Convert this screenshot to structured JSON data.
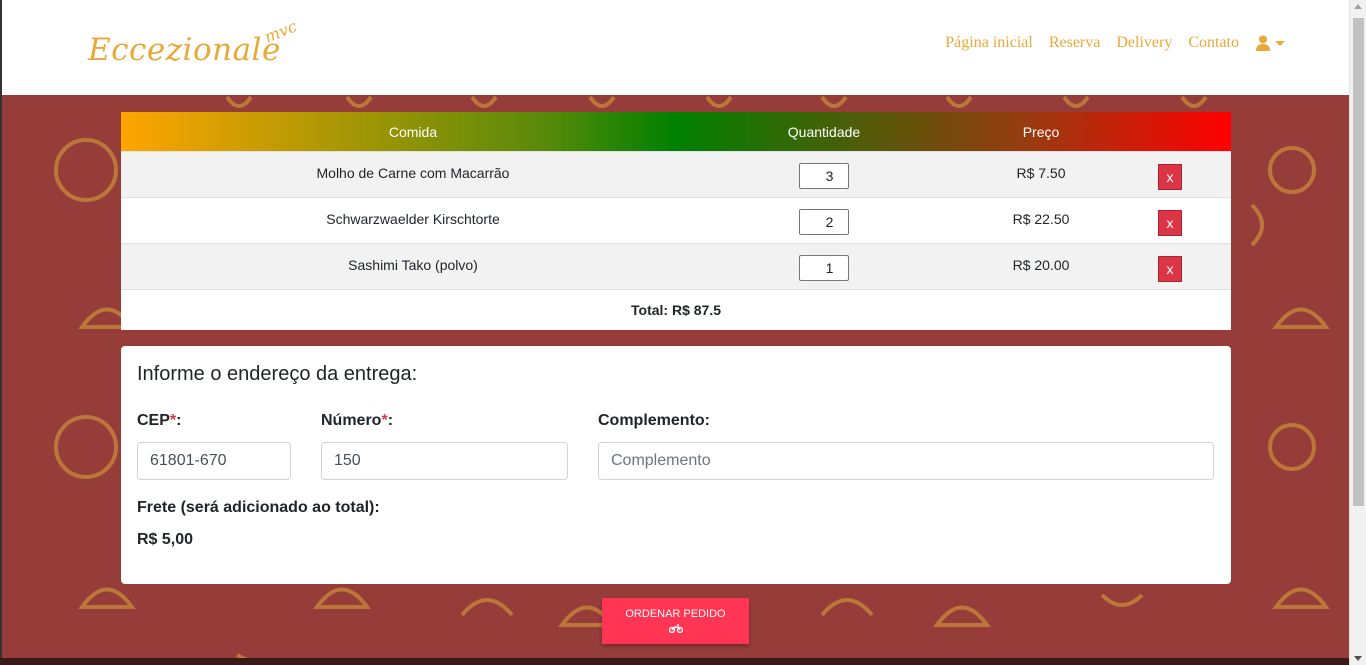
{
  "header": {
    "logo_main": "Eccezionale",
    "logo_sub": "mvc",
    "nav": [
      {
        "label": "Página inicial"
      },
      {
        "label": "Reserva"
      },
      {
        "label": "Delivery"
      },
      {
        "label": "Contato"
      }
    ],
    "user_icon": "user-icon",
    "accent_color": "#e8a938"
  },
  "cart": {
    "columns": {
      "food": "Comida",
      "quantity": "Quantidade",
      "price": "Preço"
    },
    "rows": [
      {
        "food": "Molho de Carne com Macarrão",
        "quantity": "3",
        "price": "R$ 7.50",
        "remove": "x"
      },
      {
        "food": "Schwarzwaelder Kirschtorte",
        "quantity": "2",
        "price": "R$ 22.50",
        "remove": "x"
      },
      {
        "food": "Sashimi Tako (polvo)",
        "quantity": "1",
        "price": "R$ 20.00",
        "remove": "x"
      }
    ],
    "total": "Total: R$ 87.5"
  },
  "address": {
    "title": "Informe o endereço da entrega:",
    "cep_label": "CEP",
    "cep_value": "61801-670",
    "numero_label": "Número",
    "numero_value": "150",
    "complemento_label": "Complemento:",
    "complemento_placeholder": "Complemento",
    "required_mark": "*",
    "colon": ":",
    "freight_label": "Frete (será adicionado ao total):",
    "freight_value": "R$ 5,00"
  },
  "order_button": {
    "label": "ORDENAR PEDIDO",
    "icon": "motorcycle-icon"
  },
  "colors": {
    "background": "#963d3a",
    "danger": "#dc3545",
    "order": "#ff3553"
  }
}
